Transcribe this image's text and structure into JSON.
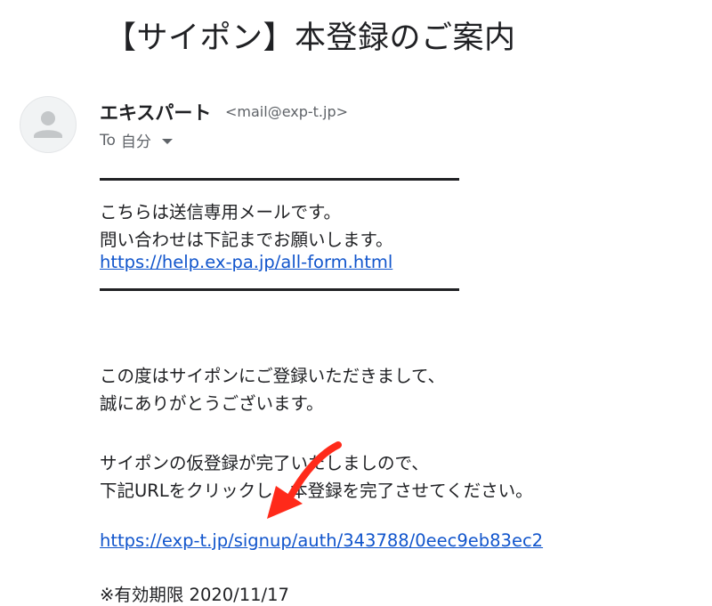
{
  "email": {
    "subject": "【サイポン】本登録のご案内",
    "sender": {
      "name": "エキスパート",
      "email": "<mail@exp-t.jp>"
    },
    "recipient": {
      "to_label": "To",
      "name": "自分"
    },
    "body": {
      "notice_line1": "こちらは送信専用メールです。",
      "notice_line2": "問い合わせは下記までお願いします。",
      "help_link": "https://help.ex-pa.jp/all-form.html",
      "thanks_line1": "この度はサイポンにご登録いただきまして、",
      "thanks_line2": "誠にありがとうございます。",
      "instruction_line1": "サイポンの仮登録が完了いたしましので、",
      "instruction_line2": "下記URLをクリックし、本登録を完了させてください。",
      "signup_link": "https://exp-t.jp/signup/auth/343788/0eec9eb83ec2",
      "expiry_partial": "※有効期限 2020/11/17"
    }
  },
  "icons": {
    "avatar": "person-icon",
    "recipient_toggle": "caret-down-icon",
    "annotation": "red-arrow-annotation"
  },
  "colors": {
    "link": "#1155cc",
    "annotation_arrow": "#ff2a1a",
    "secondary_text": "#5f6368"
  }
}
